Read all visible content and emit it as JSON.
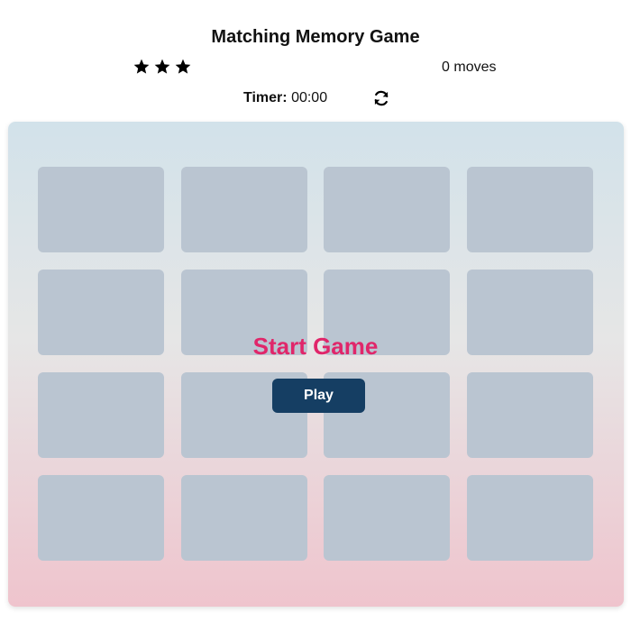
{
  "header": {
    "title": "Matching Memory Game",
    "stars": [
      "star-icon",
      "star-icon",
      "star-icon"
    ],
    "moves_count": "0",
    "moves_label": "moves",
    "timer_label": "Timer:",
    "timer_value": "00:00",
    "restart_icon": "refresh-icon"
  },
  "overlay": {
    "title": "Start Game",
    "play_label": "Play"
  },
  "board": {
    "rows": 4,
    "columns": 4,
    "card_state": "face-down"
  },
  "colors": {
    "title_accent": "#e0266a",
    "button": "#153e63",
    "card": "#bac5d1",
    "board_top": "#d2e2ea",
    "board_bottom": "#efc4cd"
  }
}
